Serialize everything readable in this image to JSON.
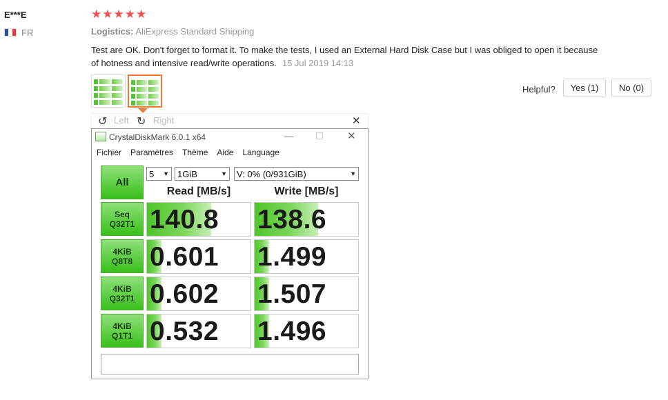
{
  "review": {
    "reviewer": "E***E",
    "country": "FR",
    "stars": "★★★★★",
    "logistics_label": "Logistics:",
    "logistics_value": "AliExpress Standard Shipping",
    "text": "Test are OK. Don't forget to format it. To make the tests, I used an External Hard Disk Case but I was obliged to open it because of hotness and intensive read/write operations.",
    "date": "15 Jul 2019 14:13",
    "rating": 5
  },
  "helpful": {
    "label": "Helpful?",
    "yes": "Yes (1)",
    "no": "No (0)"
  },
  "viewer": {
    "left": "Left",
    "right": "Right",
    "close": "✕",
    "rotate_left_icon": "↺",
    "rotate_right_icon": "↻"
  },
  "cdm": {
    "title": "CrystalDiskMark 6.0.1 x64",
    "menu": [
      "Fichier",
      "Paramètres",
      "Thème",
      "Aide",
      "Language"
    ],
    "all_label": "All",
    "count": "5",
    "size": "1GiB",
    "drive": "V: 0% (0/931GiB)",
    "read_header": "Read [MB/s]",
    "write_header": "Write [MB/s]",
    "rows": [
      {
        "line1": "Seq",
        "line2": "Q32T1",
        "read": "140.8",
        "write": "138.6",
        "read_fill": 0.62,
        "write_fill": 0.61
      },
      {
        "line1": "4KiB",
        "line2": "Q8T8",
        "read": "0.601",
        "write": "1.499",
        "read_fill": 0.14,
        "write_fill": 0.14
      },
      {
        "line1": "4KiB",
        "line2": "Q32T1",
        "read": "0.602",
        "write": "1.507",
        "read_fill": 0.14,
        "write_fill": 0.14
      },
      {
        "line1": "4KiB",
        "line2": "Q1T1",
        "read": "0.532",
        "write": "1.496",
        "read_fill": 0.14,
        "write_fill": 0.14
      }
    ],
    "minimize": "—",
    "close": "✕"
  },
  "colors": {
    "star": "#f05050",
    "accent": "#f07a35",
    "green": "#39c01b"
  }
}
